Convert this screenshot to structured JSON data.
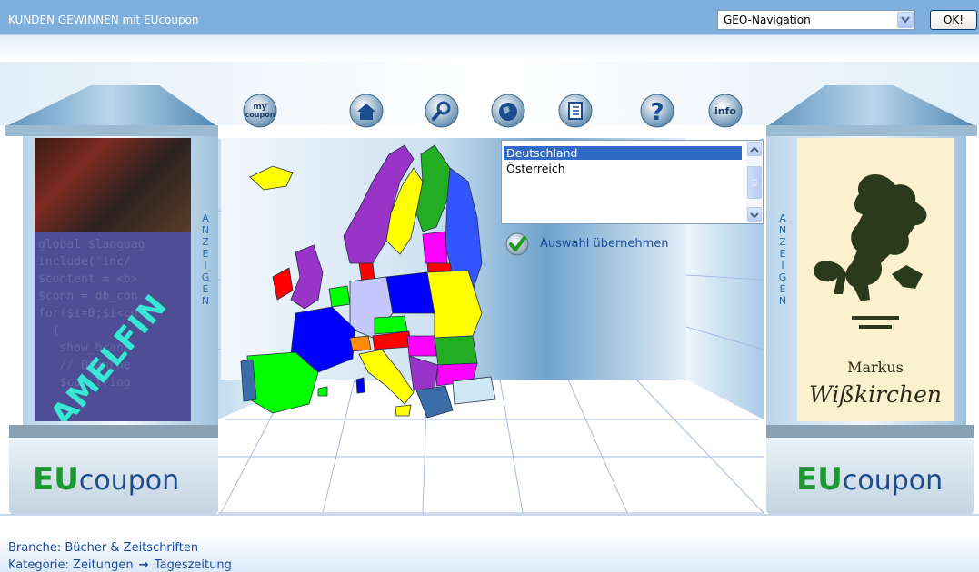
{
  "header": {
    "title": "KUNDEN GEWINNEN mit EUcoupon",
    "geo_select_value": "GEO-Navigation",
    "ok_label": "OK!"
  },
  "toolbar": {
    "items": [
      {
        "name": "mycoupon",
        "label": "my coupon"
      },
      {
        "name": "home",
        "label": ""
      },
      {
        "name": "search",
        "label": ""
      },
      {
        "name": "globe",
        "label": ""
      },
      {
        "name": "list",
        "label": ""
      },
      {
        "name": "help",
        "label": "?"
      },
      {
        "name": "info",
        "label": "info"
      }
    ]
  },
  "left_column": {
    "ad_brand": "AMELFIN",
    "ad_code": "global $languag\ninclude(\"inc/\n$content = <b>\n$conn = db_con\nfor($i=0;$i<co\n  {\n   show_branc\n   // Branche\n   $catstring",
    "vertical_label": "A\nN\nZ\nE\nI\nG\nE\nN",
    "logo_eu": "EU",
    "logo_coupon": "coupon"
  },
  "right_column": {
    "ad_name_line1": "Markus",
    "ad_name_line2": "Wißkirchen",
    "vertical_label": "A\nN\nZ\nE\nI\nG\nE\nN",
    "logo_eu": "EU",
    "logo_coupon": "coupon"
  },
  "country_list": {
    "items": [
      "Deutschland",
      "Österreich"
    ],
    "selected": "Deutschland"
  },
  "apply": {
    "label": "Auswahl übernehmen"
  },
  "footer": {
    "branche_label": "Branche:",
    "branche_value": "Bücher & Zeitschriften",
    "kategorie_label": "Kategorie:",
    "kategorie_value": "Zeitungen",
    "kategorie_sub": "Tageszeitung"
  },
  "colors": {
    "header_bar": "#7fb0dd",
    "link_blue": "#1a4c9a",
    "selection": "#3169c6",
    "eu_green": "#1a9a2e"
  }
}
